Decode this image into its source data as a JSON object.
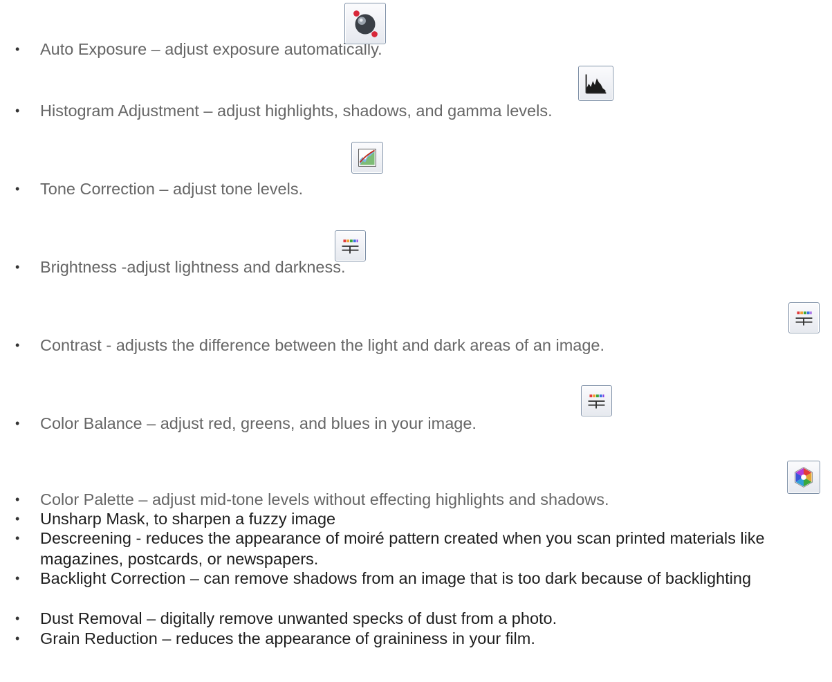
{
  "items": [
    {
      "text": "Auto Exposure – adjust exposure automatically.",
      "icon": "auto-exposure-icon"
    },
    {
      "text": "Histogram Adjustment – adjust highlights, shadows, and gamma levels.",
      "icon": "histogram-icon"
    },
    {
      "text": "Tone Correction – adjust tone levels.",
      "icon": "tone-correction-icon"
    },
    {
      "text": "Brightness -adjust lightness and darkness.",
      "icon": "image-adjustment-icon"
    },
    {
      "text": "Contrast - adjusts the difference between the light and dark areas of an image.",
      "icon": "image-adjustment-icon"
    },
    {
      "text": "Color Balance – adjust red, greens, and blues in your image.",
      "icon": "image-adjustment-icon"
    },
    {
      "text": "Color Palette – adjust mid-tone levels without effecting highlights and shadows.",
      "icon": "color-palette-icon"
    },
    {
      "text": "Unsharp Mask, to sharpen a fuzzy image"
    },
    {
      "text": "Descreening - reduces the appearance of moiré pattern created when you scan printed materials like magazines, postcards, or newspapers."
    },
    {
      "text": "Backlight Correction – can remove shadows from an image that is too dark because of backlighting"
    },
    {
      "text": "Dust Removal – digitally remove unwanted specks of dust from a photo."
    },
    {
      "text": "Grain Reduction – reduces the appearance of graininess in your film."
    }
  ],
  "bullet": "•"
}
